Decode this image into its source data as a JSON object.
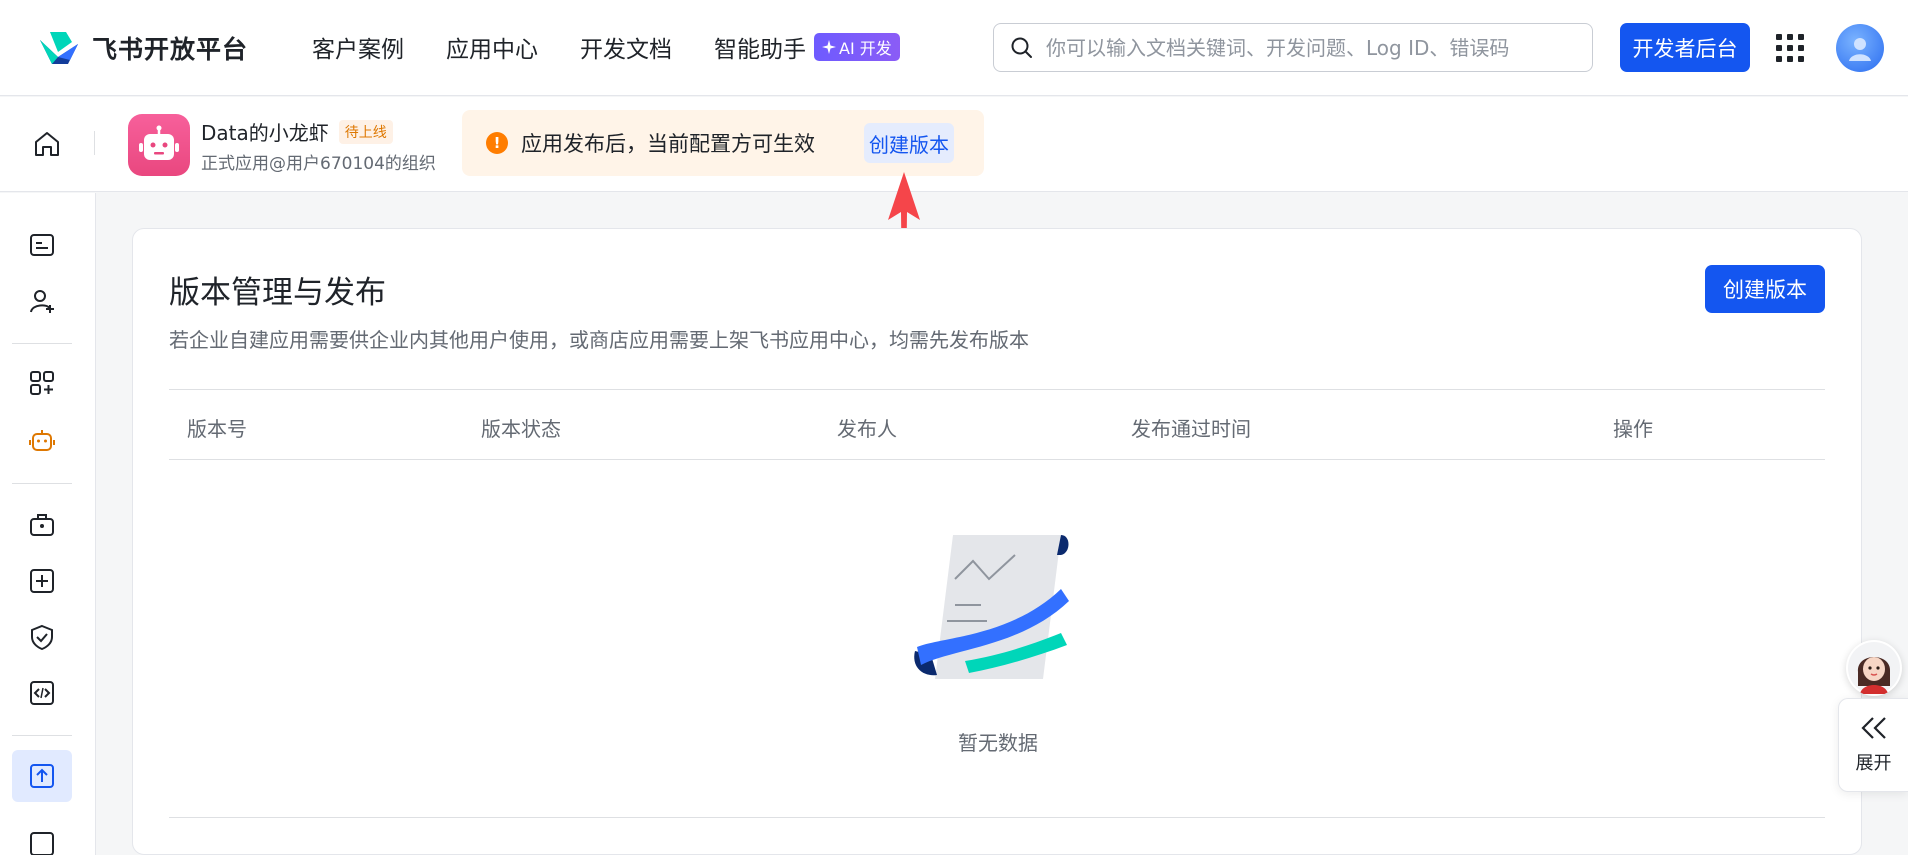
{
  "brand": {
    "name": "飞书开放平台"
  },
  "nav": {
    "items": [
      "客户案例",
      "应用中心",
      "开发文档",
      "智能助手"
    ],
    "ai_badge": "AI 开发"
  },
  "search": {
    "placeholder": "你可以输入文档关键词、开发问题、Log ID、错误码"
  },
  "header_actions": {
    "dev_console": "开发者后台"
  },
  "app": {
    "name": "Data的小龙虾",
    "status_tag": "待上线",
    "org": "正式应用@用户670104的组织"
  },
  "notice": {
    "icon": "!",
    "text": "应用发布后，当前配置方可生效",
    "link": "创建版本"
  },
  "page": {
    "title": "版本管理与发布",
    "description": "若企业自建应用需要供企业内其他用户使用，或商店应用需要上架飞书应用中心，均需先发布版本",
    "create_button": "创建版本",
    "columns": [
      "版本号",
      "版本状态",
      "发布人",
      "发布通过时间",
      "操作"
    ],
    "empty_text": "暂无数据"
  },
  "float": {
    "expand_label": "展开"
  },
  "colors": {
    "primary": "#1456f0",
    "warning": "#ff7d00",
    "arrow": "#f5454a"
  }
}
